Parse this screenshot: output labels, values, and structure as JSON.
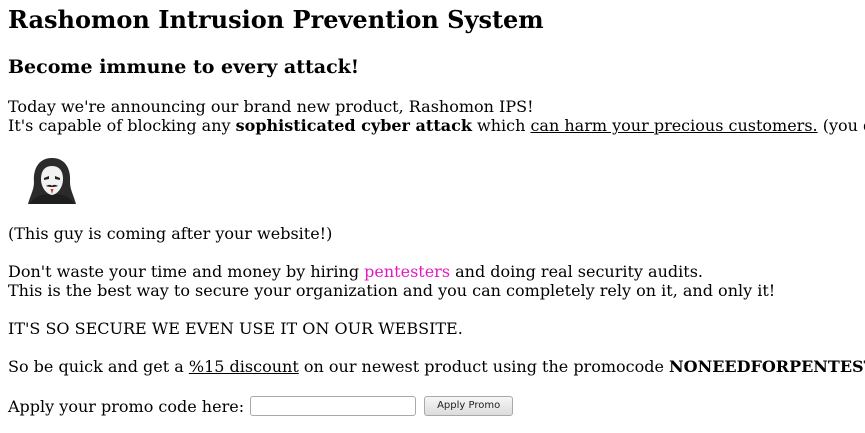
{
  "header": {
    "title": "Rashomon Intrusion Prevention System",
    "subtitle": "Become immune to every attack!"
  },
  "intro": {
    "line1": "Today we're announcing our brand new product, Rashomon IPS!",
    "line2_prefix": "It's capable of blocking any ",
    "line2_bold": "sophisticated cyber attack",
    "line2_middle": " which ",
    "line2_link": "can harm your precious customers.",
    "line2_suffix": " (you d"
  },
  "image": {
    "icon": "anonymous-hacker-icon",
    "caption": "(This guy is coming after your website!)"
  },
  "pitch": {
    "line1_prefix": "Don't waste your time and money by hiring ",
    "line1_link": "pentesters",
    "line1_suffix": " and doing real security audits.",
    "line2": "This is the best way to secure your organization and you can completely rely on it, and only it!"
  },
  "secure_note": "IT'S SO SECURE WE EVEN USE IT ON OUR WEBSITE.",
  "offer": {
    "prefix": "So be quick and get a ",
    "discount": "%15 discount",
    "middle": " on our newest product using the promocode ",
    "code": "NONEEDFORPENTEST"
  },
  "promo": {
    "label": "Apply your promo code here:",
    "input_value": "",
    "button_label": "Apply Promo"
  },
  "colors": {
    "link_pink": "#e619c0",
    "text": "#000000",
    "background": "#ffffff"
  }
}
